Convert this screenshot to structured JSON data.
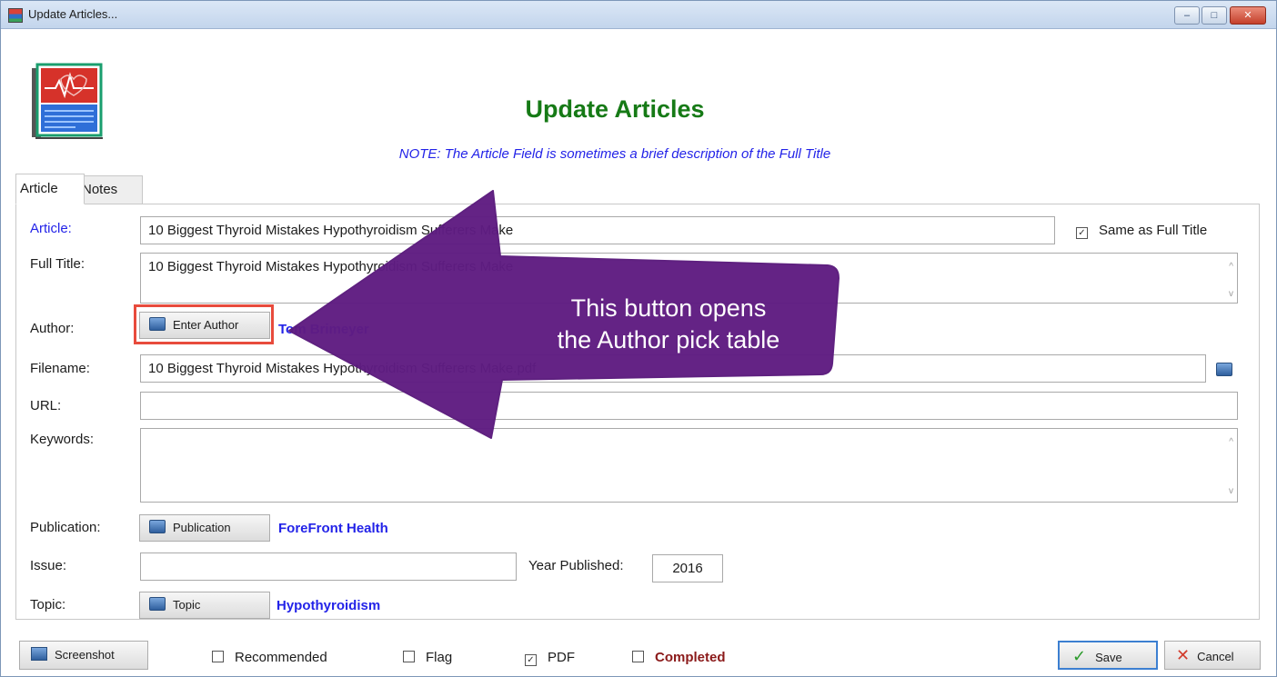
{
  "window": {
    "title": "Update Articles...",
    "controls": {
      "minimize": "–",
      "maximize": "□",
      "close": "✕"
    }
  },
  "header": {
    "title": "Update Articles",
    "note": "NOTE: The Article Field is sometimes a brief description of the Full Title"
  },
  "tabs": [
    "Article",
    "Notes"
  ],
  "form": {
    "article_label": "Article:",
    "article_value": "10 Biggest Thyroid Mistakes Hypothyroidism Sufferers Make",
    "same_as_full_title_label": "Same as Full Title",
    "same_as_full_title_checked": true,
    "full_title_label": "Full Title:",
    "full_title_value": "10 Biggest Thyroid Mistakes Hypothyroidism Sufferers Make",
    "author_label": "Author:",
    "author_button": "Enter Author",
    "author_value": "Tom Brimeyer",
    "filename_label": "Filename:",
    "filename_value": "10 Biggest Thyroid Mistakes Hypothyroidism Sufferers Make.pdf",
    "url_label": "URL:",
    "url_value": "",
    "keywords_label": "Keywords:",
    "keywords_value": "",
    "publication_label": "Publication:",
    "publication_button": "Publication",
    "publication_value": "ForeFront Health",
    "issue_label": "Issue:",
    "issue_value": "",
    "year_label": "Year Published:",
    "year_value": "2016",
    "topic_label": "Topic:",
    "topic_button": "Topic",
    "topic_value": "Hypothyroidism"
  },
  "footer": {
    "screenshot_button": "Screenshot",
    "recommended_label": "Recommended",
    "flag_label": "Flag",
    "pdf_label": "PDF",
    "pdf_checked": true,
    "completed_label": "Completed",
    "save_button": "Save",
    "cancel_button": "Cancel"
  },
  "callout": {
    "line1": "This button opens",
    "line2": "the Author pick table",
    "color": "#5f1c82"
  },
  "colors": {
    "heading": "#167a16",
    "note": "#2323e8",
    "link": "#2323e8",
    "completed": "#8b1a1a",
    "highlight": "#e84b3c"
  }
}
